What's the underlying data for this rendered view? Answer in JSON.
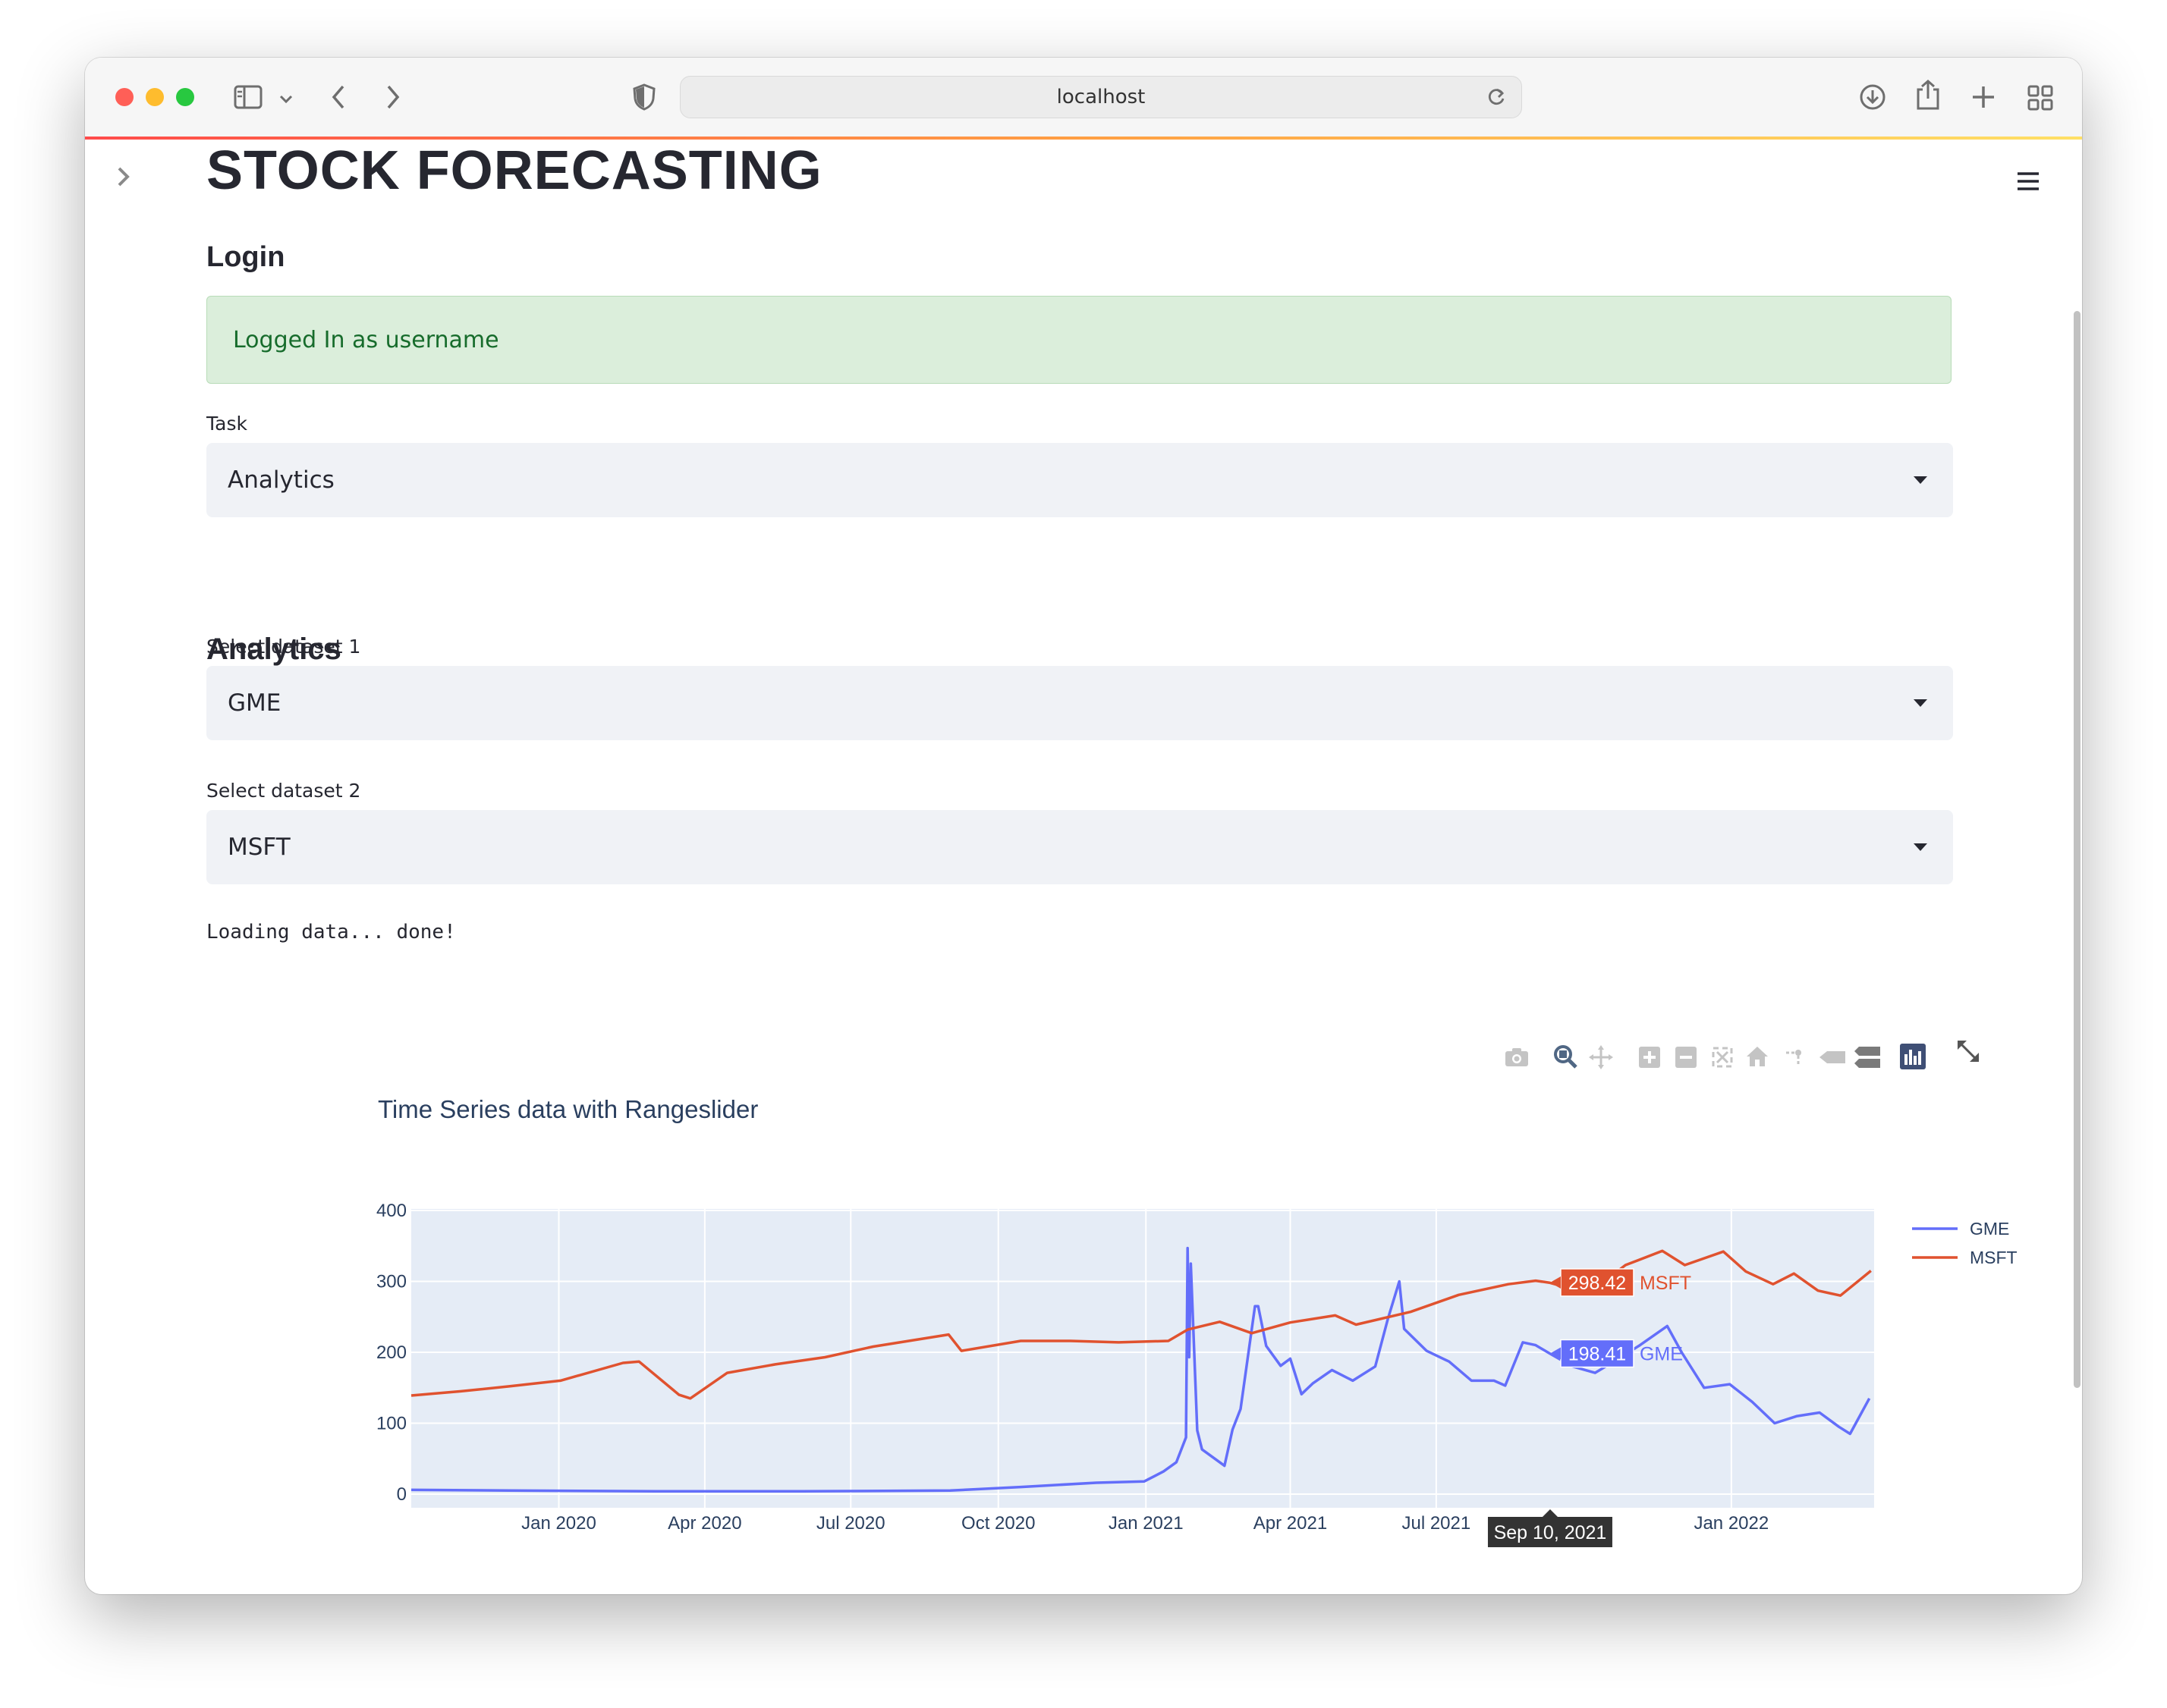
{
  "browser": {
    "url": "localhost"
  },
  "page": {
    "title": "STOCK FORECASTING",
    "login_heading": "Login",
    "login_status": "Logged In as username",
    "task_label": "Task",
    "task_value": "Analytics",
    "analytics_heading": "Analytics",
    "dataset1_label": "Select dataset 1",
    "dataset1_value": "GME",
    "dataset2_label": "Select dataset 2",
    "dataset2_value": "MSFT",
    "loading_text": "Loading data... done!"
  },
  "colors": {
    "gme": "#636efa",
    "msft": "#e0522f",
    "plot_bg": "#e5ecf6",
    "success_text": "#176c2c"
  },
  "icons": [
    "camera-icon",
    "zoom-icon",
    "pan-icon",
    "zoom-in-icon",
    "zoom-out-icon",
    "autoscale-icon",
    "reset-axes-icon",
    "spike-lines-icon",
    "hover-closest-icon",
    "hover-compare-icon",
    "plotly-logo-icon",
    "fullscreen-icon",
    "sidebar-toggle-icon",
    "hamburger-menu-icon"
  ],
  "chart_data": {
    "type": "line",
    "title": "Time Series data with Rangeslider",
    "x_tick_labels": [
      "Jan 2020",
      "Apr 2020",
      "Jul 2020",
      "Oct 2020",
      "Jan 2021",
      "Apr 2021",
      "Jul 2021",
      "Jan 2022"
    ],
    "y_tick_labels": [
      "0",
      "100",
      "200",
      "300",
      "400"
    ],
    "ylim": [
      0,
      400
    ],
    "xrange": [
      "2019-10-01",
      "2022-03-31"
    ],
    "grid": true,
    "legend_position": "top-right",
    "hover": {
      "date": "Sep 10, 2021",
      "values": [
        {
          "series": "MSFT",
          "value": "298.42"
        },
        {
          "series": "GME",
          "value": "198.41"
        }
      ]
    },
    "series": [
      {
        "name": "GME",
        "color": "#636efa",
        "points": [
          [
            "2019-10-01",
            6
          ],
          [
            "2019-12-01",
            5
          ],
          [
            "2020-03-01",
            4
          ],
          [
            "2020-06-01",
            4
          ],
          [
            "2020-09-01",
            5
          ],
          [
            "2020-10-15",
            10
          ],
          [
            "2020-12-01",
            16
          ],
          [
            "2020-12-31",
            18
          ],
          [
            "2021-01-12",
            32
          ],
          [
            "2021-01-20",
            45
          ],
          [
            "2021-01-26",
            80
          ],
          [
            "2021-01-27",
            347
          ],
          [
            "2021-01-28",
            193
          ],
          [
            "2021-01-29",
            325
          ],
          [
            "2021-02-02",
            90
          ],
          [
            "2021-02-05",
            63
          ],
          [
            "2021-02-19",
            40
          ],
          [
            "2021-02-24",
            91
          ],
          [
            "2021-03-01",
            120
          ],
          [
            "2021-03-10",
            265
          ],
          [
            "2021-03-12",
            265
          ],
          [
            "2021-03-17",
            209
          ],
          [
            "2021-03-26",
            181
          ],
          [
            "2021-04-01",
            191
          ],
          [
            "2021-04-08",
            141
          ],
          [
            "2021-04-15",
            156
          ],
          [
            "2021-04-27",
            175
          ],
          [
            "2021-05-10",
            160
          ],
          [
            "2021-05-24",
            180
          ],
          [
            "2021-06-01",
            248
          ],
          [
            "2021-06-08",
            300
          ],
          [
            "2021-06-11",
            233
          ],
          [
            "2021-06-25",
            202
          ],
          [
            "2021-07-09",
            187
          ],
          [
            "2021-07-23",
            160
          ],
          [
            "2021-08-06",
            160
          ],
          [
            "2021-08-13",
            153
          ],
          [
            "2021-08-24",
            214
          ],
          [
            "2021-09-01",
            210
          ],
          [
            "2021-09-10",
            198
          ],
          [
            "2021-09-24",
            180
          ],
          [
            "2021-10-08",
            171
          ],
          [
            "2021-10-22",
            190
          ],
          [
            "2021-11-05",
            210
          ],
          [
            "2021-11-22",
            237
          ],
          [
            "2021-12-01",
            200
          ],
          [
            "2021-12-15",
            150
          ],
          [
            "2021-12-31",
            155
          ],
          [
            "2022-01-14",
            130
          ],
          [
            "2022-01-28",
            100
          ],
          [
            "2022-02-11",
            110
          ],
          [
            "2022-02-25",
            115
          ],
          [
            "2022-03-09",
            95
          ],
          [
            "2022-03-16",
            85
          ],
          [
            "2022-03-28",
            135
          ]
        ]
      },
      {
        "name": "MSFT",
        "color": "#e0522f",
        "points": [
          [
            "2019-10-01",
            139
          ],
          [
            "2019-11-01",
            145
          ],
          [
            "2019-12-01",
            152
          ],
          [
            "2020-01-02",
            160
          ],
          [
            "2020-02-10",
            185
          ],
          [
            "2020-02-20",
            187
          ],
          [
            "2020-03-16",
            140
          ],
          [
            "2020-03-23",
            135
          ],
          [
            "2020-04-15",
            171
          ],
          [
            "2020-05-15",
            183
          ],
          [
            "2020-06-15",
            193
          ],
          [
            "2020-07-15",
            208
          ],
          [
            "2020-08-31",
            225
          ],
          [
            "2020-09-08",
            202
          ],
          [
            "2020-10-15",
            216
          ],
          [
            "2020-11-15",
            216
          ],
          [
            "2020-12-15",
            214
          ],
          [
            "2021-01-15",
            216
          ],
          [
            "2021-01-27",
            232
          ],
          [
            "2021-02-16",
            243
          ],
          [
            "2021-03-08",
            227
          ],
          [
            "2021-04-01",
            242
          ],
          [
            "2021-04-29",
            252
          ],
          [
            "2021-05-12",
            239
          ],
          [
            "2021-06-15",
            257
          ],
          [
            "2021-07-15",
            281
          ],
          [
            "2021-08-15",
            296
          ],
          [
            "2021-09-01",
            301
          ],
          [
            "2021-09-10",
            298
          ],
          [
            "2021-10-04",
            283
          ],
          [
            "2021-10-27",
            323
          ],
          [
            "2021-11-19",
            343
          ],
          [
            "2021-12-03",
            323
          ],
          [
            "2021-12-27",
            342
          ],
          [
            "2022-01-10",
            314
          ],
          [
            "2022-01-27",
            296
          ],
          [
            "2022-02-09",
            311
          ],
          [
            "2022-02-24",
            287
          ],
          [
            "2022-03-10",
            280
          ],
          [
            "2022-03-29",
            315
          ]
        ]
      }
    ],
    "rangeslider": {
      "range_start": "2021-01-01",
      "range_end": "2022-03-31"
    }
  }
}
